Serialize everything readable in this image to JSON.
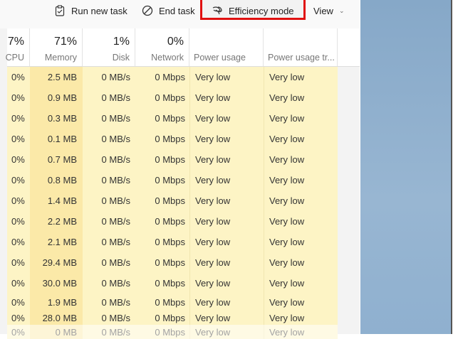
{
  "toolbar": {
    "run_new_task": "Run new task",
    "end_task": "End task",
    "efficiency_mode": "Efficiency mode",
    "view": "View"
  },
  "headers": [
    {
      "pct": "7%",
      "label": "CPU"
    },
    {
      "pct": "71%",
      "label": "Memory"
    },
    {
      "pct": "1%",
      "label": "Disk"
    },
    {
      "pct": "0%",
      "label": "Network"
    },
    {
      "pct": "",
      "label": "Power usage"
    },
    {
      "pct": "",
      "label": "Power usage tr..."
    }
  ],
  "rows": [
    [
      "0%",
      "2.5 MB",
      "0 MB/s",
      "0 Mbps",
      "Very low",
      "Very low"
    ],
    [
      "0%",
      "0.9 MB",
      "0 MB/s",
      "0 Mbps",
      "Very low",
      "Very low"
    ],
    [
      "0%",
      "0.3 MB",
      "0 MB/s",
      "0 Mbps",
      "Very low",
      "Very low"
    ],
    [
      "0%",
      "0.1 MB",
      "0 MB/s",
      "0 Mbps",
      "Very low",
      "Very low"
    ],
    [
      "0%",
      "0.7 MB",
      "0 MB/s",
      "0 Mbps",
      "Very low",
      "Very low"
    ],
    [
      "0%",
      "0.8 MB",
      "0 MB/s",
      "0 Mbps",
      "Very low",
      "Very low"
    ],
    [
      "0%",
      "1.4 MB",
      "0 MB/s",
      "0 Mbps",
      "Very low",
      "Very low"
    ],
    [
      "0%",
      "2.2 MB",
      "0 MB/s",
      "0 Mbps",
      "Very low",
      "Very low"
    ],
    [
      "0%",
      "2.1 MB",
      "0 MB/s",
      "0 Mbps",
      "Very low",
      "Very low"
    ],
    [
      "0%",
      "29.4 MB",
      "0 MB/s",
      "0 Mbps",
      "Very low",
      "Very low"
    ],
    [
      "0%",
      "30.0 MB",
      "0 MB/s",
      "0 Mbps",
      "Very low",
      "Very low"
    ],
    [
      "0%",
      "1.9 MB",
      "0 MB/s",
      "0 Mbps",
      "Very low",
      "Very low"
    ],
    [
      "0%",
      "28.0 MB",
      "0 MB/s",
      "0 Mbps",
      "Very low",
      "Very low"
    ],
    [
      "0%",
      "0 MB",
      "0 MB/s",
      "0 Mbps",
      "Very low",
      "Very low"
    ]
  ]
}
